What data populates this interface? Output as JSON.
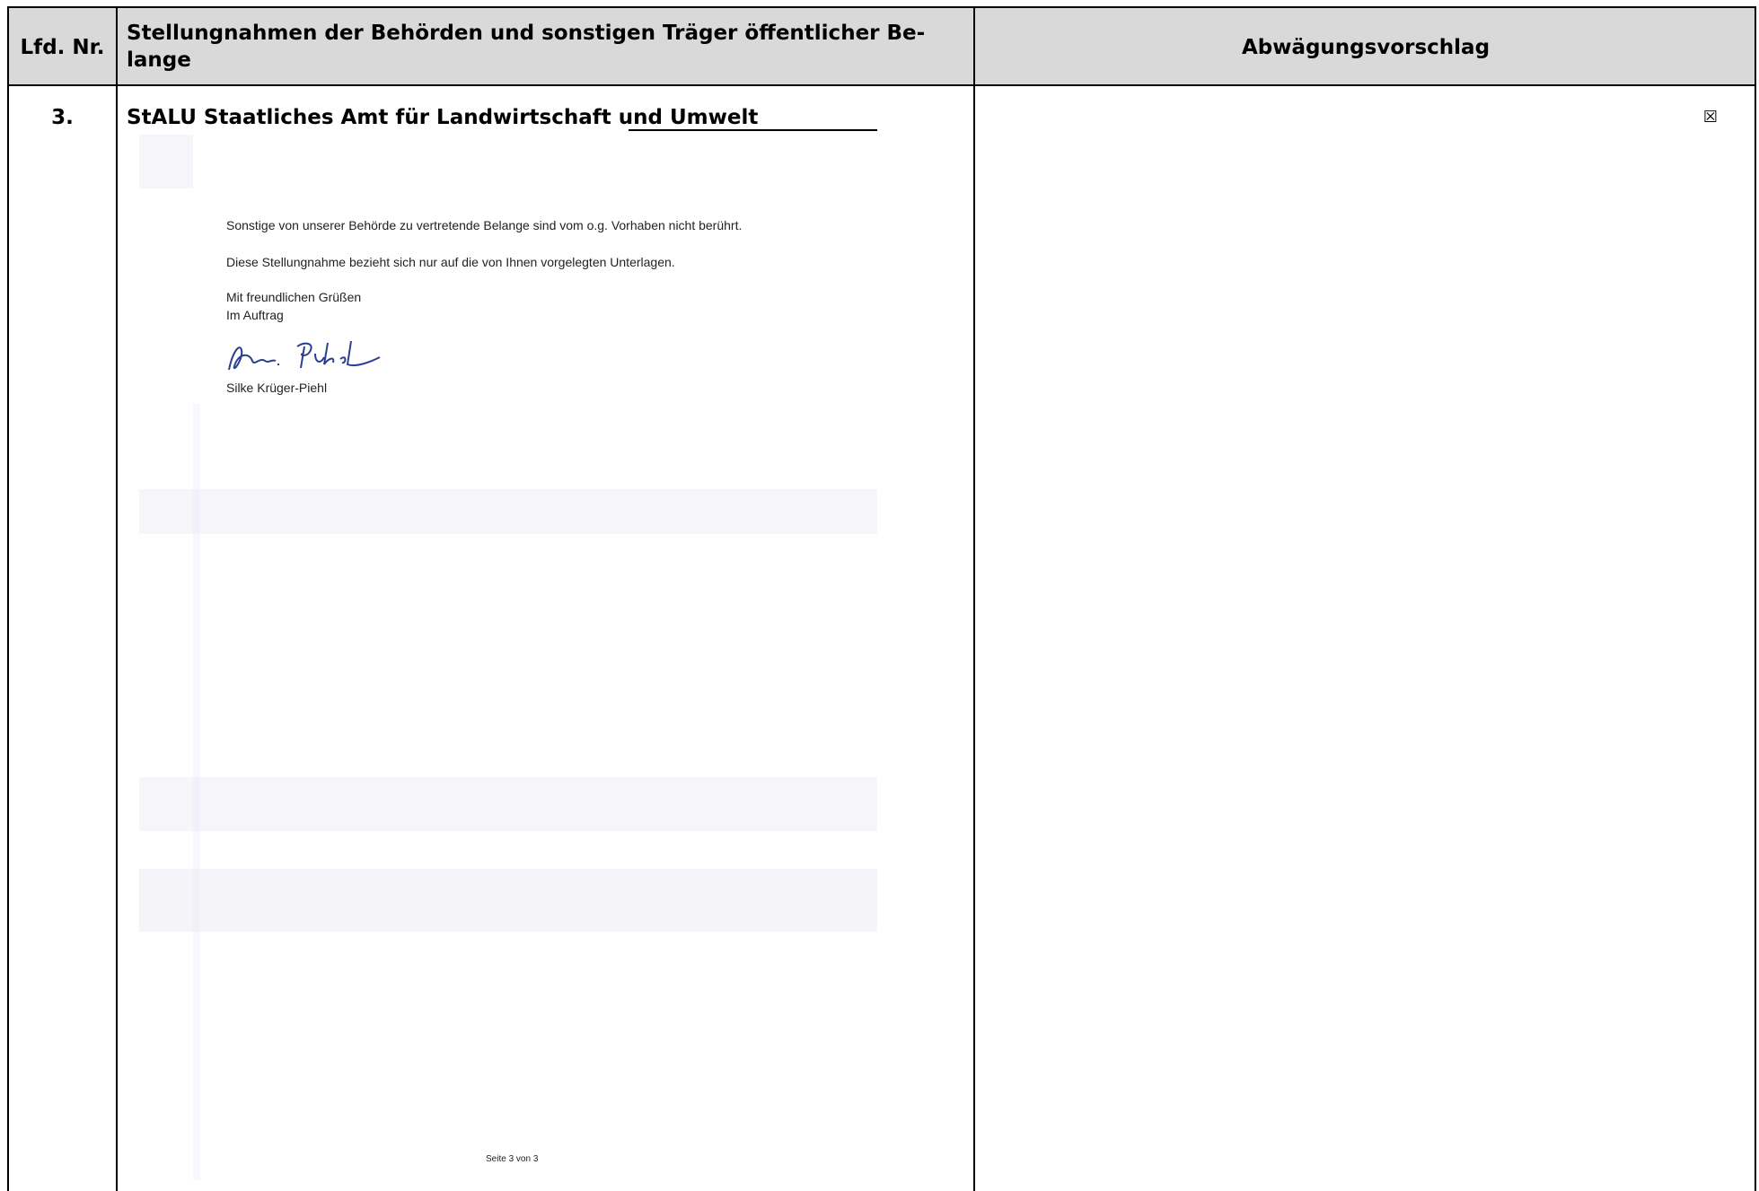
{
  "header": {
    "nr_label": "Lfd. Nr.",
    "stellungnahme_label": "Stellungnahmen der Behörden und sonstigen Träger öffentlicher Be-lange",
    "stellungnahme_line1": "Stellungnahmen der Behörden und sonstigen Träger öffentlicher Be-",
    "stellungnahme_line2": "lange",
    "abwaegung_label": "Abwägungsvorschlag"
  },
  "row": {
    "number": "3.",
    "title": "StALU Staatliches Amt für Landwirtschaft und Umwelt",
    "checkbox_symbol": "☒"
  },
  "letter": {
    "line1": "Sonstige von unserer Behörde zu vertretende Belange sind vom o.g. Vorhaben nicht berührt.",
    "line2": "Diese Stellungnahme bezieht sich nur auf die von Ihnen vorgelegten Unterlagen.",
    "greeting": "Mit freundlichen Grüßen",
    "im_auftrag": "Im Auftrag",
    "signatory": "Silke Krüger-Piehl",
    "page_number": "Seite 3 von 3"
  },
  "colors": {
    "header_bg": "#d9d9d9",
    "border": "#000000",
    "signature_ink": "#2a3f8f"
  }
}
